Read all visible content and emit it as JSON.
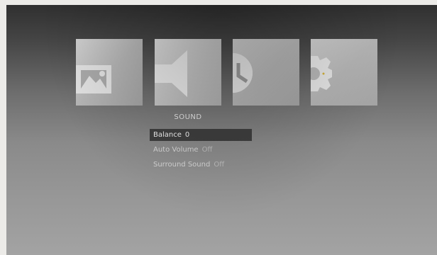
{
  "tiles": [
    {
      "icon": "picture-icon",
      "selected": false
    },
    {
      "icon": "speaker-icon",
      "selected": true
    },
    {
      "icon": "clock-icon",
      "selected": false
    },
    {
      "icon": "gear-icon",
      "selected": false
    }
  ],
  "section_title": "SOUND",
  "menu": {
    "items": [
      {
        "label": "Balance",
        "value": "0",
        "highlighted": true
      },
      {
        "label": "Auto Volume",
        "value": "Off",
        "highlighted": false
      },
      {
        "label": "Surround Sound",
        "value": "Off",
        "highlighted": false
      }
    ]
  },
  "colors": {
    "tile_fill": "#c4c4c4",
    "highlight_bar": "#3f3f3f",
    "text": "#e6e6e6"
  }
}
